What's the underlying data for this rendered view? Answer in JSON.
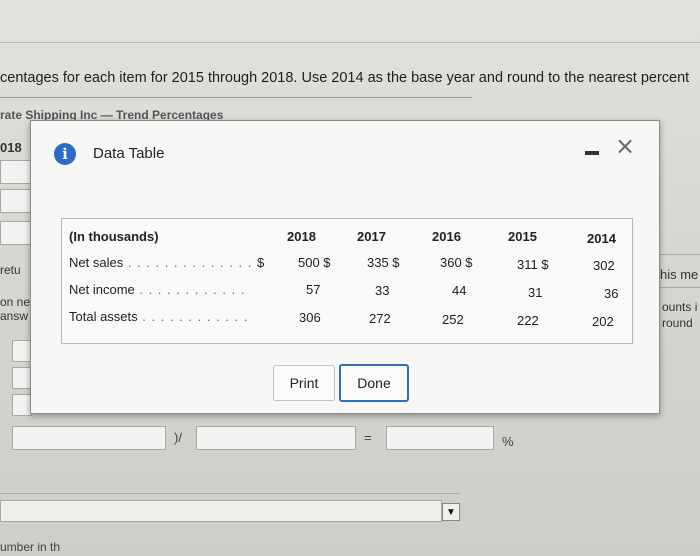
{
  "background": {
    "instruction": "centages for each item for 2015 through 2018. Use 2014 as the base year and round to the nearest percent",
    "partial_title": "rate Shipping Inc — Trend Percentages",
    "left_fragments": [
      "018",
      "retu",
      "on ne",
      "answ"
    ],
    "right_fragments": [
      "his me",
      "ounts i",
      "round"
    ],
    "formula_sep1": ")/",
    "formula_sep2": "=",
    "formula_sep3": "%",
    "bottom_fragment": "umber in th"
  },
  "dialog": {
    "title": "Data Table",
    "table": {
      "columns": [
        "(In thousands)",
        "2018",
        "2017",
        "2016",
        "2015",
        "2014"
      ],
      "rows": [
        {
          "label": "Net sales",
          "prefix": "$",
          "values": [
            "500 $",
            "335 $",
            "360 $",
            "311 $",
            "302"
          ]
        },
        {
          "label": "Net income",
          "prefix": "",
          "values": [
            "57",
            "33",
            "44",
            "31",
            "36"
          ]
        },
        {
          "label": "Total assets",
          "prefix": "",
          "values": [
            "306",
            "272",
            "252",
            "222",
            "202"
          ]
        }
      ]
    },
    "print_label": "Print",
    "done_label": "Done"
  }
}
